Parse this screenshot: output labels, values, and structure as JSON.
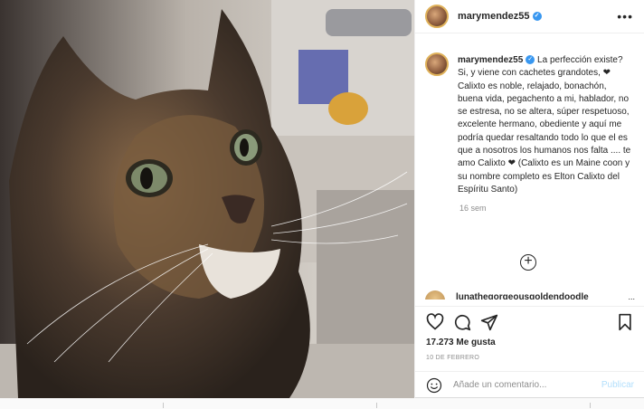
{
  "post": {
    "username": "marymendez55",
    "verified_icon": "verified-badge-icon",
    "more_icon": "more-options-icon"
  },
  "caption": {
    "username": "marymendez55",
    "text": " La perfección existe? Si, y viene con cachetes grandotes, ❤ Calixto es noble, relajado, bonachón, buena vida, pegachento a mi, hablador, no se estresa, no se altera, súper respetuoso, excelente hermano, obediente y aquí me podría quedar resaltando todo lo que el es que a nosotros los humanos nos falta .... te amo Calixto ❤ (Calixto es un Maine coon y su nombre completo es Elton Calixto del Espíritu Santo)",
    "time": "16 sem"
  },
  "load_more_icon": "plus-circle-icon",
  "second_comment": {
    "username": "lunathegorgeousgoldendoodle",
    "more": "..."
  },
  "actions": {
    "like_icon": "heart-icon",
    "comment_icon": "comment-icon",
    "share_icon": "share-icon",
    "save_icon": "bookmark-icon"
  },
  "likes": "17.273 Me gusta",
  "date": "10 DE FEBRERO",
  "add_comment": {
    "emoji_icon": "emoji-icon",
    "placeholder": "Añade un comentario...",
    "publish_label": "Publicar"
  },
  "colors": {
    "accent": "#3897f0",
    "publish_disabled": "#b2dffc",
    "secondary_text": "#8e8e8e"
  }
}
